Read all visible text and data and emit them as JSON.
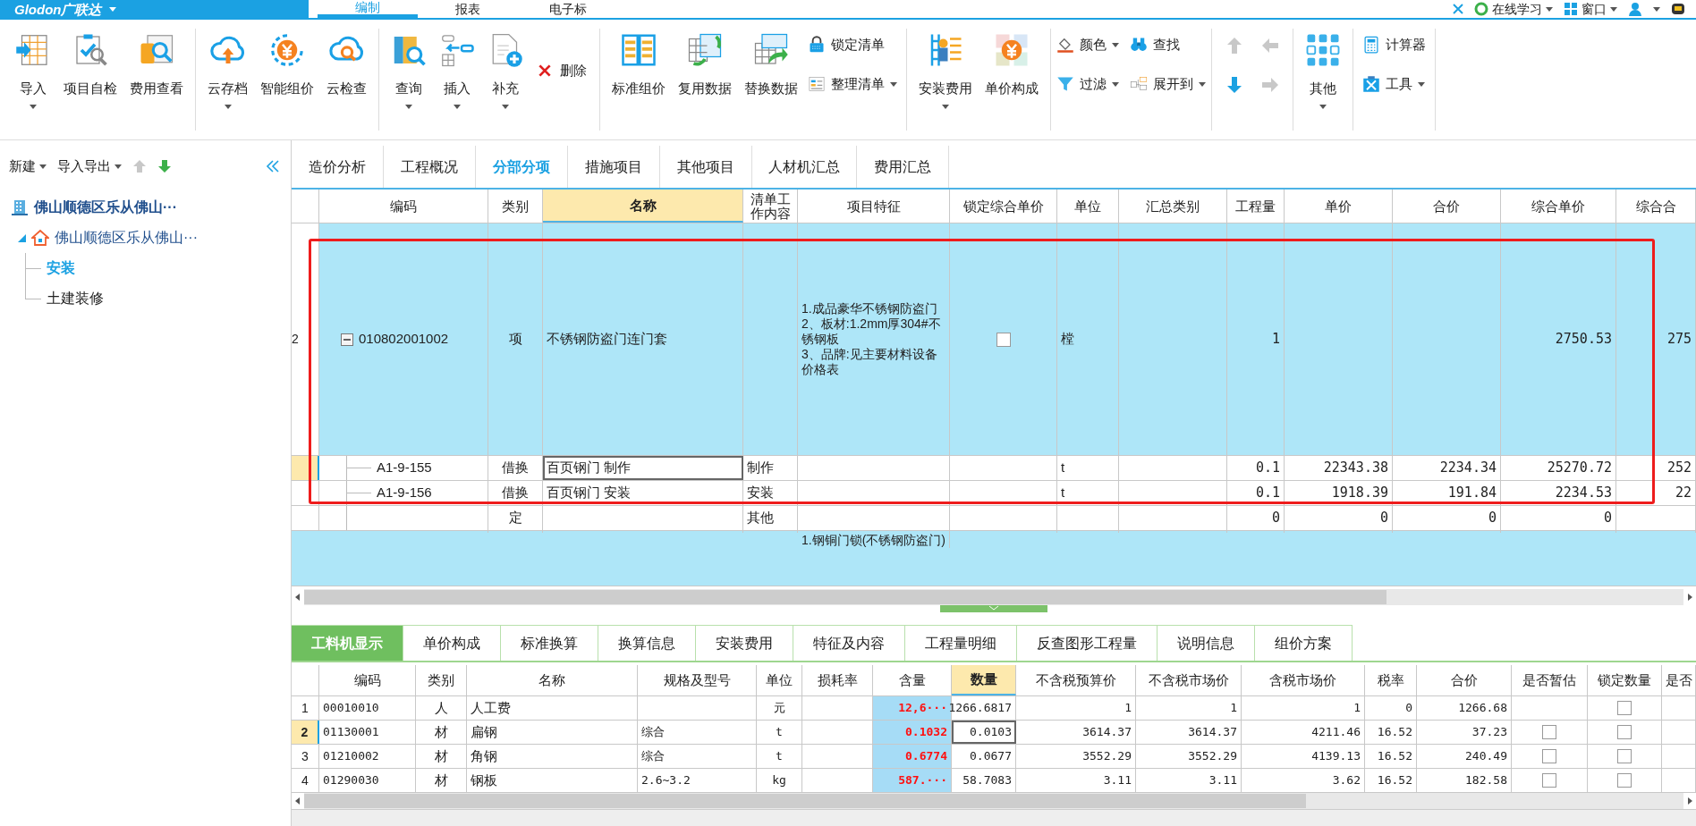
{
  "title_bar": {
    "logo": "Glodon广联达",
    "tabs": [
      {
        "label": "编制",
        "selected": true
      },
      {
        "label": "报表",
        "selected": false
      },
      {
        "label": "电子标",
        "selected": false
      }
    ],
    "right_items": [
      {
        "label": "在线学习",
        "dropdown": true
      },
      {
        "label": "窗口",
        "dropdown": true
      }
    ]
  },
  "ribbon": {
    "groups": [
      {
        "items": [
          {
            "kind": "large",
            "label": "导入",
            "dropdown": true
          },
          {
            "kind": "large",
            "label": "项目自检",
            "dropdown": false
          },
          {
            "kind": "large",
            "label": "费用查看",
            "dropdown": false
          }
        ]
      },
      {
        "items": [
          {
            "kind": "large",
            "label": "云存档",
            "dropdown": true
          },
          {
            "kind": "large",
            "label": "智能组价",
            "dropdown": false
          },
          {
            "kind": "large",
            "label": "云检查",
            "dropdown": false
          }
        ]
      },
      {
        "items": [
          {
            "kind": "large",
            "label": "查询",
            "dropdown": true
          },
          {
            "kind": "large",
            "label": "插入",
            "dropdown": true
          },
          {
            "kind": "large",
            "label": "补充",
            "dropdown": true
          },
          {
            "kind": "small",
            "label": "删除",
            "dropdown": false
          }
        ]
      },
      {
        "items": [
          {
            "kind": "large",
            "label": "标准组价",
            "dropdown": false
          },
          {
            "kind": "large",
            "label": "复用数据",
            "dropdown": false
          },
          {
            "kind": "large",
            "label": "替换数据",
            "dropdown": false
          },
          {
            "kind": "stack",
            "items": [
              {
                "label": "锁定清单",
                "dropdown": false
              },
              {
                "label": "整理清单",
                "dropdown": true
              }
            ]
          }
        ]
      },
      {
        "items": [
          {
            "kind": "large",
            "label": "安装费用",
            "dropdown": true
          },
          {
            "kind": "large",
            "label": "单价构成",
            "dropdown": false
          }
        ]
      },
      {
        "items": [
          {
            "kind": "grid",
            "items": [
              {
                "label": "颜色",
                "dropdown": true
              },
              {
                "label": "查找",
                "dropdown": false
              },
              {
                "label": "过滤",
                "dropdown": true
              },
              {
                "label": "展开到",
                "dropdown": true
              }
            ]
          }
        ]
      },
      {
        "items": [
          {
            "kind": "arrows",
            "items": [
              {
                "disabled": true
              },
              {
                "disabled": true
              },
              {
                "disabled": false
              },
              {
                "disabled": true
              }
            ]
          }
        ]
      },
      {
        "items": [
          {
            "kind": "large",
            "label": "其他",
            "dropdown": true
          }
        ]
      },
      {
        "items": [
          {
            "kind": "stack",
            "items": [
              {
                "label": "计算器",
                "dropdown": false
              },
              {
                "label": "工具",
                "dropdown": true
              }
            ]
          }
        ]
      }
    ]
  },
  "sidebar": {
    "toolbar": [
      {
        "label": "新建",
        "dropdown": true
      },
      {
        "label": "导入导出",
        "dropdown": true
      }
    ],
    "move_buttons": [
      {
        "disabled": true
      },
      {
        "disabled": false
      }
    ],
    "tree": [
      {
        "label": "佛山顺德区乐从佛山···",
        "children": [
          {
            "label": "佛山顺德区乐从佛山···",
            "expanded": true,
            "children": [
              {
                "label": "安装",
                "selected": true
              },
              {
                "label": "土建装修",
                "selected": false
              }
            ]
          }
        ]
      }
    ]
  },
  "tabs": [
    {
      "label": "造价分析",
      "selected": false
    },
    {
      "label": "工程概况",
      "selected": false
    },
    {
      "label": "分部分项",
      "selected": true
    },
    {
      "label": "措施项目",
      "selected": false
    },
    {
      "label": "其他项目",
      "selected": false
    },
    {
      "label": "人材机汇总",
      "selected": false
    },
    {
      "label": "费用汇总",
      "selected": false
    }
  ],
  "table": {
    "columns": [
      {
        "label": "编码",
        "selected": false
      },
      {
        "label": "类别",
        "selected": false
      },
      {
        "label": "名称",
        "selected": true
      },
      {
        "label": "清单工作内容",
        "selected": false
      },
      {
        "label": "项目特征",
        "selected": false
      },
      {
        "label": "锁定综合单价",
        "selected": false
      },
      {
        "label": "单位",
        "selected": false
      },
      {
        "label": "汇总类别",
        "selected": false
      },
      {
        "label": "工程量",
        "selected": false
      },
      {
        "label": "单价",
        "selected": false
      },
      {
        "label": "合价",
        "selected": false
      },
      {
        "label": "综合单价",
        "selected": false
      },
      {
        "label": "综合合",
        "selected": false
      }
    ],
    "rows": [
      {
        "kind": "item",
        "selected": false,
        "num": "2",
        "expanded": true,
        "locked": false,
        "code": "010802001002",
        "type": "项",
        "name": "不锈钢防盗门连门套",
        "feature": "1.成品豪华不锈钢防盗门\n2、板材:1.2mm厚304#不锈钢板\n3、品牌:见主要材料设备价格表",
        "unit": "樘",
        "qty": "1",
        "unit_total": "2750.53",
        "column_13": "275"
      },
      {
        "kind": "sub",
        "selected": true,
        "code": "A1-9-155",
        "type": "借换",
        "name": "百页钢门 制作",
        "work": "制作",
        "unit": "t",
        "qty": "0.1",
        "price": "22343.38",
        "total": "2234.34",
        "unit_total": "25270.72",
        "column_13": "252"
      },
      {
        "kind": "sub",
        "selected": false,
        "code": "A1-9-156",
        "type": "借换",
        "name": "百页钢门 安装",
        "work": "安装",
        "unit": "t",
        "qty": "0.1",
        "price": "1918.39",
        "total": "191.84",
        "unit_total": "2234.53",
        "column_13": "22"
      },
      {
        "kind": "sub",
        "selected": false,
        "type": "定",
        "work": "其他",
        "qty": "0",
        "price": "0",
        "total": "0",
        "unit_total": "0"
      },
      {
        "kind": "item",
        "selected": false,
        "feature": "1.钢铜门锁(不锈钢防盗门)"
      }
    ]
  },
  "bottom_tabs": [
    {
      "label": "工料机显示",
      "selected": true
    },
    {
      "label": "单价构成",
      "selected": false
    },
    {
      "label": "标准换算",
      "selected": false
    },
    {
      "label": "换算信息",
      "selected": false
    },
    {
      "label": "安装费用",
      "selected": false
    },
    {
      "label": "特征及内容",
      "selected": false
    },
    {
      "label": "工程量明细",
      "selected": false
    },
    {
      "label": "反查图形工程量",
      "selected": false
    },
    {
      "label": "说明信息",
      "selected": false
    },
    {
      "label": "组价方案",
      "selected": false
    }
  ],
  "resource_table": {
    "columns": [
      {
        "label": "编码",
        "selected": false
      },
      {
        "label": "类别",
        "selected": false
      },
      {
        "label": "名称",
        "selected": false
      },
      {
        "label": "规格及型号",
        "selected": false
      },
      {
        "label": "单位",
        "selected": false
      },
      {
        "label": "损耗率",
        "selected": false
      },
      {
        "label": "含量",
        "selected": false
      },
      {
        "label": "数量",
        "selected": true
      },
      {
        "label": "不含税预算价",
        "selected": false
      },
      {
        "label": "不含税市场价",
        "selected": false
      },
      {
        "label": "含税市场价",
        "selected": false
      },
      {
        "label": "税率",
        "selected": false
      },
      {
        "label": "合价",
        "selected": false
      },
      {
        "label": "是否暂估",
        "selected": false
      },
      {
        "label": "锁定数量",
        "selected": false
      },
      {
        "label": "是否",
        "selected": false
      }
    ],
    "rows": [
      {
        "num": "1",
        "selected": false,
        "code": "00010010",
        "type": "人",
        "name": "人工费",
        "unit": "元",
        "content": "12,6···",
        "quantity": "1266.6817",
        "budget_price": "1",
        "market_price": "1",
        "tax_market_price": "1",
        "tax_rate": "0",
        "total": "1266.68",
        "lock_qty": false
      },
      {
        "num": "2",
        "selected": true,
        "code": "01130001",
        "type": "材",
        "name": "扁钢",
        "spec": "综合",
        "unit": "t",
        "content": "0.1032",
        "quantity": "0.0103",
        "budget_price": "3614.37",
        "market_price": "3614.37",
        "tax_market_price": "4211.46",
        "tax_rate": "16.52",
        "total": "37.23",
        "estimated": false,
        "lock_qty": false
      },
      {
        "num": "3",
        "selected": false,
        "code": "01210002",
        "type": "材",
        "name": "角钢",
        "spec": "综合",
        "unit": "t",
        "content": "0.6774",
        "quantity": "0.0677",
        "budget_price": "3552.29",
        "market_price": "3552.29",
        "tax_market_price": "4139.13",
        "tax_rate": "16.52",
        "total": "240.49",
        "estimated": false,
        "lock_qty": false
      },
      {
        "num": "4",
        "selected": false,
        "code": "01290030",
        "type": "材",
        "name": "钢板",
        "spec": "2.6~3.2",
        "unit": "kg",
        "content": "587.···",
        "quantity": "58.7083",
        "budget_price": "3.11",
        "market_price": "3.11",
        "tax_market_price": "3.62",
        "tax_rate": "16.52",
        "total": "182.58",
        "estimated": false,
        "lock_qty": false
      }
    ]
  }
}
